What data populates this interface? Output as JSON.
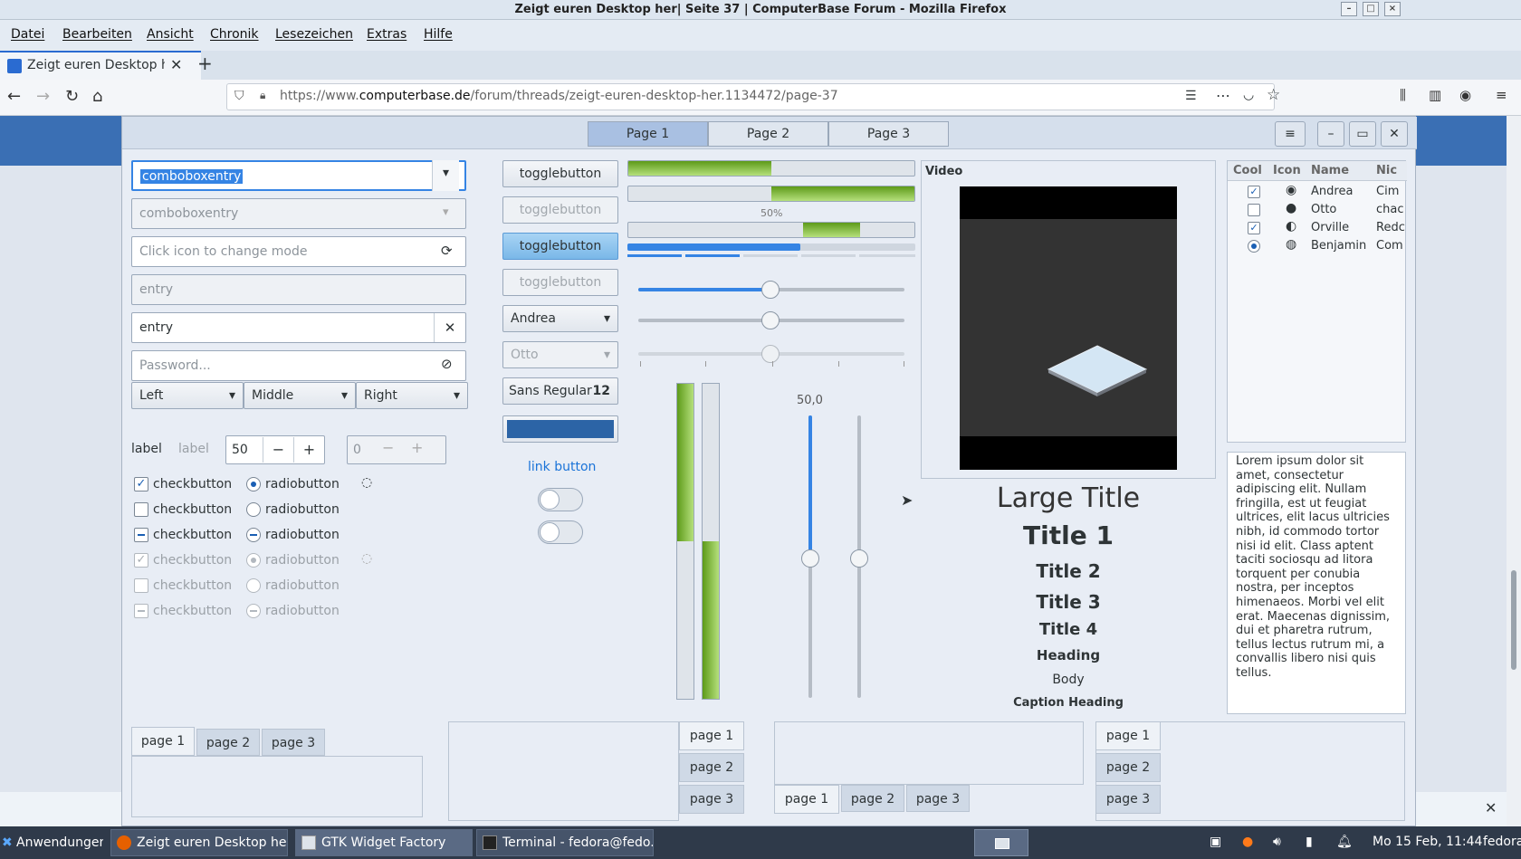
{
  "window": {
    "title": "Zeigt euren Desktop her| Seite 37 | ComputerBase Forum - Mozilla Firefox"
  },
  "menu": [
    "Datei",
    "Bearbeiten",
    "Ansicht",
    "Chronik",
    "Lesezeichen",
    "Extras",
    "Hilfe"
  ],
  "browser_tab": {
    "title": "Zeigt euren Desktop her",
    "new_tab": "+"
  },
  "url": {
    "prefix": "https://www.",
    "domain": "computerbase.de",
    "path": "/forum/threads/zeigt-euren-desktop-her.1134472/page-37"
  },
  "gtk": {
    "page_tabs": [
      "Page 1",
      "Page 2",
      "Page 3"
    ],
    "combo1": "comboboxentry",
    "combo2": "comboboxentry",
    "icon_entry_placeholder": "Click icon to change mode",
    "entry_disabled_placeholder": "entry",
    "entry_value": "entry",
    "password_placeholder": "Password...",
    "align_combos": [
      "Left",
      "Middle",
      "Right"
    ],
    "label1": "label",
    "label2": "label",
    "spin1": "50",
    "spin2": "0",
    "checkbuttons": [
      "checkbutton",
      "checkbutton",
      "checkbutton",
      "checkbutton",
      "checkbutton",
      "checkbutton"
    ],
    "radiobuttons": [
      "radiobutton",
      "radiobutton",
      "radiobutton",
      "radiobutton",
      "radiobutton",
      "radiobutton"
    ],
    "togglebuttons": [
      "togglebutton",
      "togglebutton",
      "togglebutton",
      "togglebutton"
    ],
    "combo_andrea": "Andrea",
    "combo_otto": "Otto",
    "font_button": {
      "name": "Sans Regular",
      "size": "12"
    },
    "color_button": "#2c64a6",
    "link_button": "link button",
    "progress_label": "50%",
    "progress_values": [
      0.5,
      0.5,
      0.2,
      0.6
    ],
    "scale_value_label": "50,0",
    "video_title": "Video",
    "typography": [
      "Large Title",
      "Title 1",
      "Title 2",
      "Title 3",
      "Title 4",
      "Heading",
      "Body",
      "Caption Heading"
    ],
    "tree_columns": [
      "Cool",
      "Icon",
      "Name",
      "Nic"
    ],
    "tree_rows": [
      {
        "name": "Andrea",
        "nick": "Cim"
      },
      {
        "name": "Otto",
        "nick": "chac"
      },
      {
        "name": "Orville",
        "nick": "Redc"
      },
      {
        "name": "Benjamin",
        "nick": "Com"
      }
    ],
    "lorem": "Lorem ipsum dolor sit amet, consectetur adipiscing elit. Nullam fringilla, est ut feugiat ultrices, elit lacus ultricies nibh, id commodo tortor nisi id elit. Class aptent taciti sociosqu ad litora torquent per conubia nostra, per inceptos himenaeos. Morbi vel elit erat. Maecenas dignissim, dui et pharetra rutrum, tellus lectus rutrum mi, a convallis libero nisi quis tellus.",
    "notebook_tabs": [
      "page 1",
      "page 2",
      "page 3"
    ]
  },
  "taskbar": {
    "apps_label": "Anwendungen",
    "items": [
      "Zeigt euren Desktop he...",
      "GTK Widget Factory",
      "Terminal - fedora@fedo..."
    ],
    "clock": "Mo 15 Feb, 11:44",
    "user": "fedora"
  },
  "colors": {
    "accent": "#3584e4",
    "progress": "#73b234",
    "page_strip": "#3a6fb4"
  }
}
